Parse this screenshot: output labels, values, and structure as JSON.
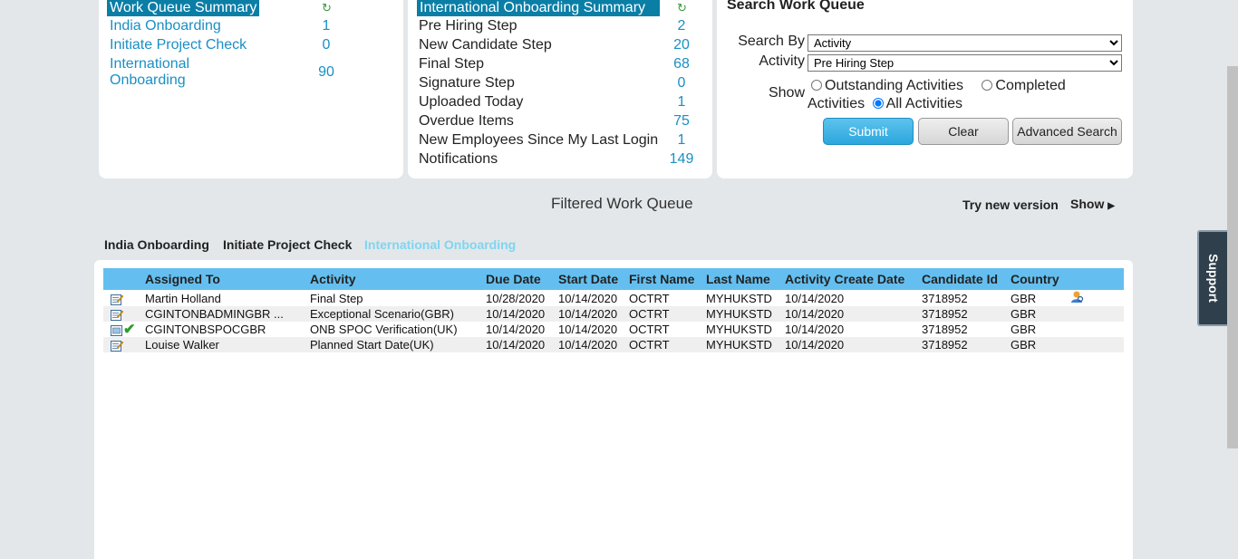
{
  "work_queue_summary": {
    "title": "Work Queue Summary",
    "refresh_icon": "refresh-icon",
    "items": [
      {
        "label": "India Onboarding",
        "count": "1"
      },
      {
        "label": "Initiate Project Check",
        "count": "0"
      },
      {
        "label_line1": "International",
        "label_line2": "Onboarding",
        "count": "90"
      }
    ]
  },
  "intl_onboarding_summary": {
    "title": "International Onboarding Summary",
    "refresh_icon": "refresh-icon",
    "items": [
      {
        "label": "Pre Hiring Step",
        "count": "2"
      },
      {
        "label": "New Candidate Step",
        "count": "20"
      },
      {
        "label": "Final Step",
        "count": "68"
      },
      {
        "label": "Signature Step",
        "count": "0"
      },
      {
        "label": "Uploaded Today",
        "count": "1"
      },
      {
        "label": "Overdue Items",
        "count": "75"
      },
      {
        "label": "New Employees Since My Last Login",
        "count": "1"
      },
      {
        "label": "Notifications",
        "count": "149"
      }
    ]
  },
  "search": {
    "title": "Search Work Queue",
    "search_by_label": "Search By",
    "search_by_value": "Activity",
    "activity_label": "Activity",
    "activity_value": "Pre Hiring Step",
    "show_label": "Show",
    "options": {
      "outstanding": "Outstanding Activities",
      "completed": "Completed Activities",
      "all": "All Activities"
    },
    "selected": "All Activities",
    "submit": "Submit",
    "clear": "Clear",
    "advanced": "Advanced Search"
  },
  "filtered": {
    "title": "Filtered Work Queue",
    "try_new": "Try new version",
    "show": "Show"
  },
  "tabs": [
    {
      "label": "India Onboarding",
      "active": false
    },
    {
      "label": "Initiate Project Check",
      "active": false
    },
    {
      "label": "International Onboarding",
      "active": true
    }
  ],
  "table": {
    "columns": [
      "Assigned To",
      "Activity",
      "Due Date",
      "Start Date",
      "First Name",
      "Last Name",
      "Activity Create Date",
      "Candidate Id",
      "Country"
    ],
    "rows": [
      {
        "assigned": "Martin Holland",
        "activity": "Final Step",
        "due": "10/28/2020",
        "start": "10/14/2020",
        "first": "OCTRT",
        "last": "MYHUKSTD",
        "created": "10/14/2020",
        "candidate": "3718952",
        "country": "GBR"
      },
      {
        "assigned": "CGINTONBADMINGBR ...",
        "activity": "Exceptional Scenario(GBR)",
        "due": "10/14/2020",
        "start": "10/14/2020",
        "first": "OCTRT",
        "last": "MYHUKSTD",
        "created": "10/14/2020",
        "candidate": "3718952",
        "country": "GBR"
      },
      {
        "assigned": "CGINTONBSPOCGBR",
        "activity": "ONB SPOC Verification(UK)",
        "due": "10/14/2020",
        "start": "10/14/2020",
        "first": "OCTRT",
        "last": "MYHUKSTD",
        "created": "10/14/2020",
        "candidate": "3718952",
        "country": "GBR"
      },
      {
        "assigned": "Louise Walker",
        "activity": "Planned Start Date(UK)",
        "due": "10/14/2020",
        "start": "10/14/2020",
        "first": "OCTRT",
        "last": "MYHUKSTD",
        "created": "10/14/2020",
        "candidate": "3718952",
        "country": "GBR"
      }
    ]
  },
  "support": "Support",
  "colors": {
    "accent": "#0b7ea6",
    "link": "#1a8fc4",
    "table_header": "#64bff0",
    "active_tab": "#7fd5f0"
  }
}
